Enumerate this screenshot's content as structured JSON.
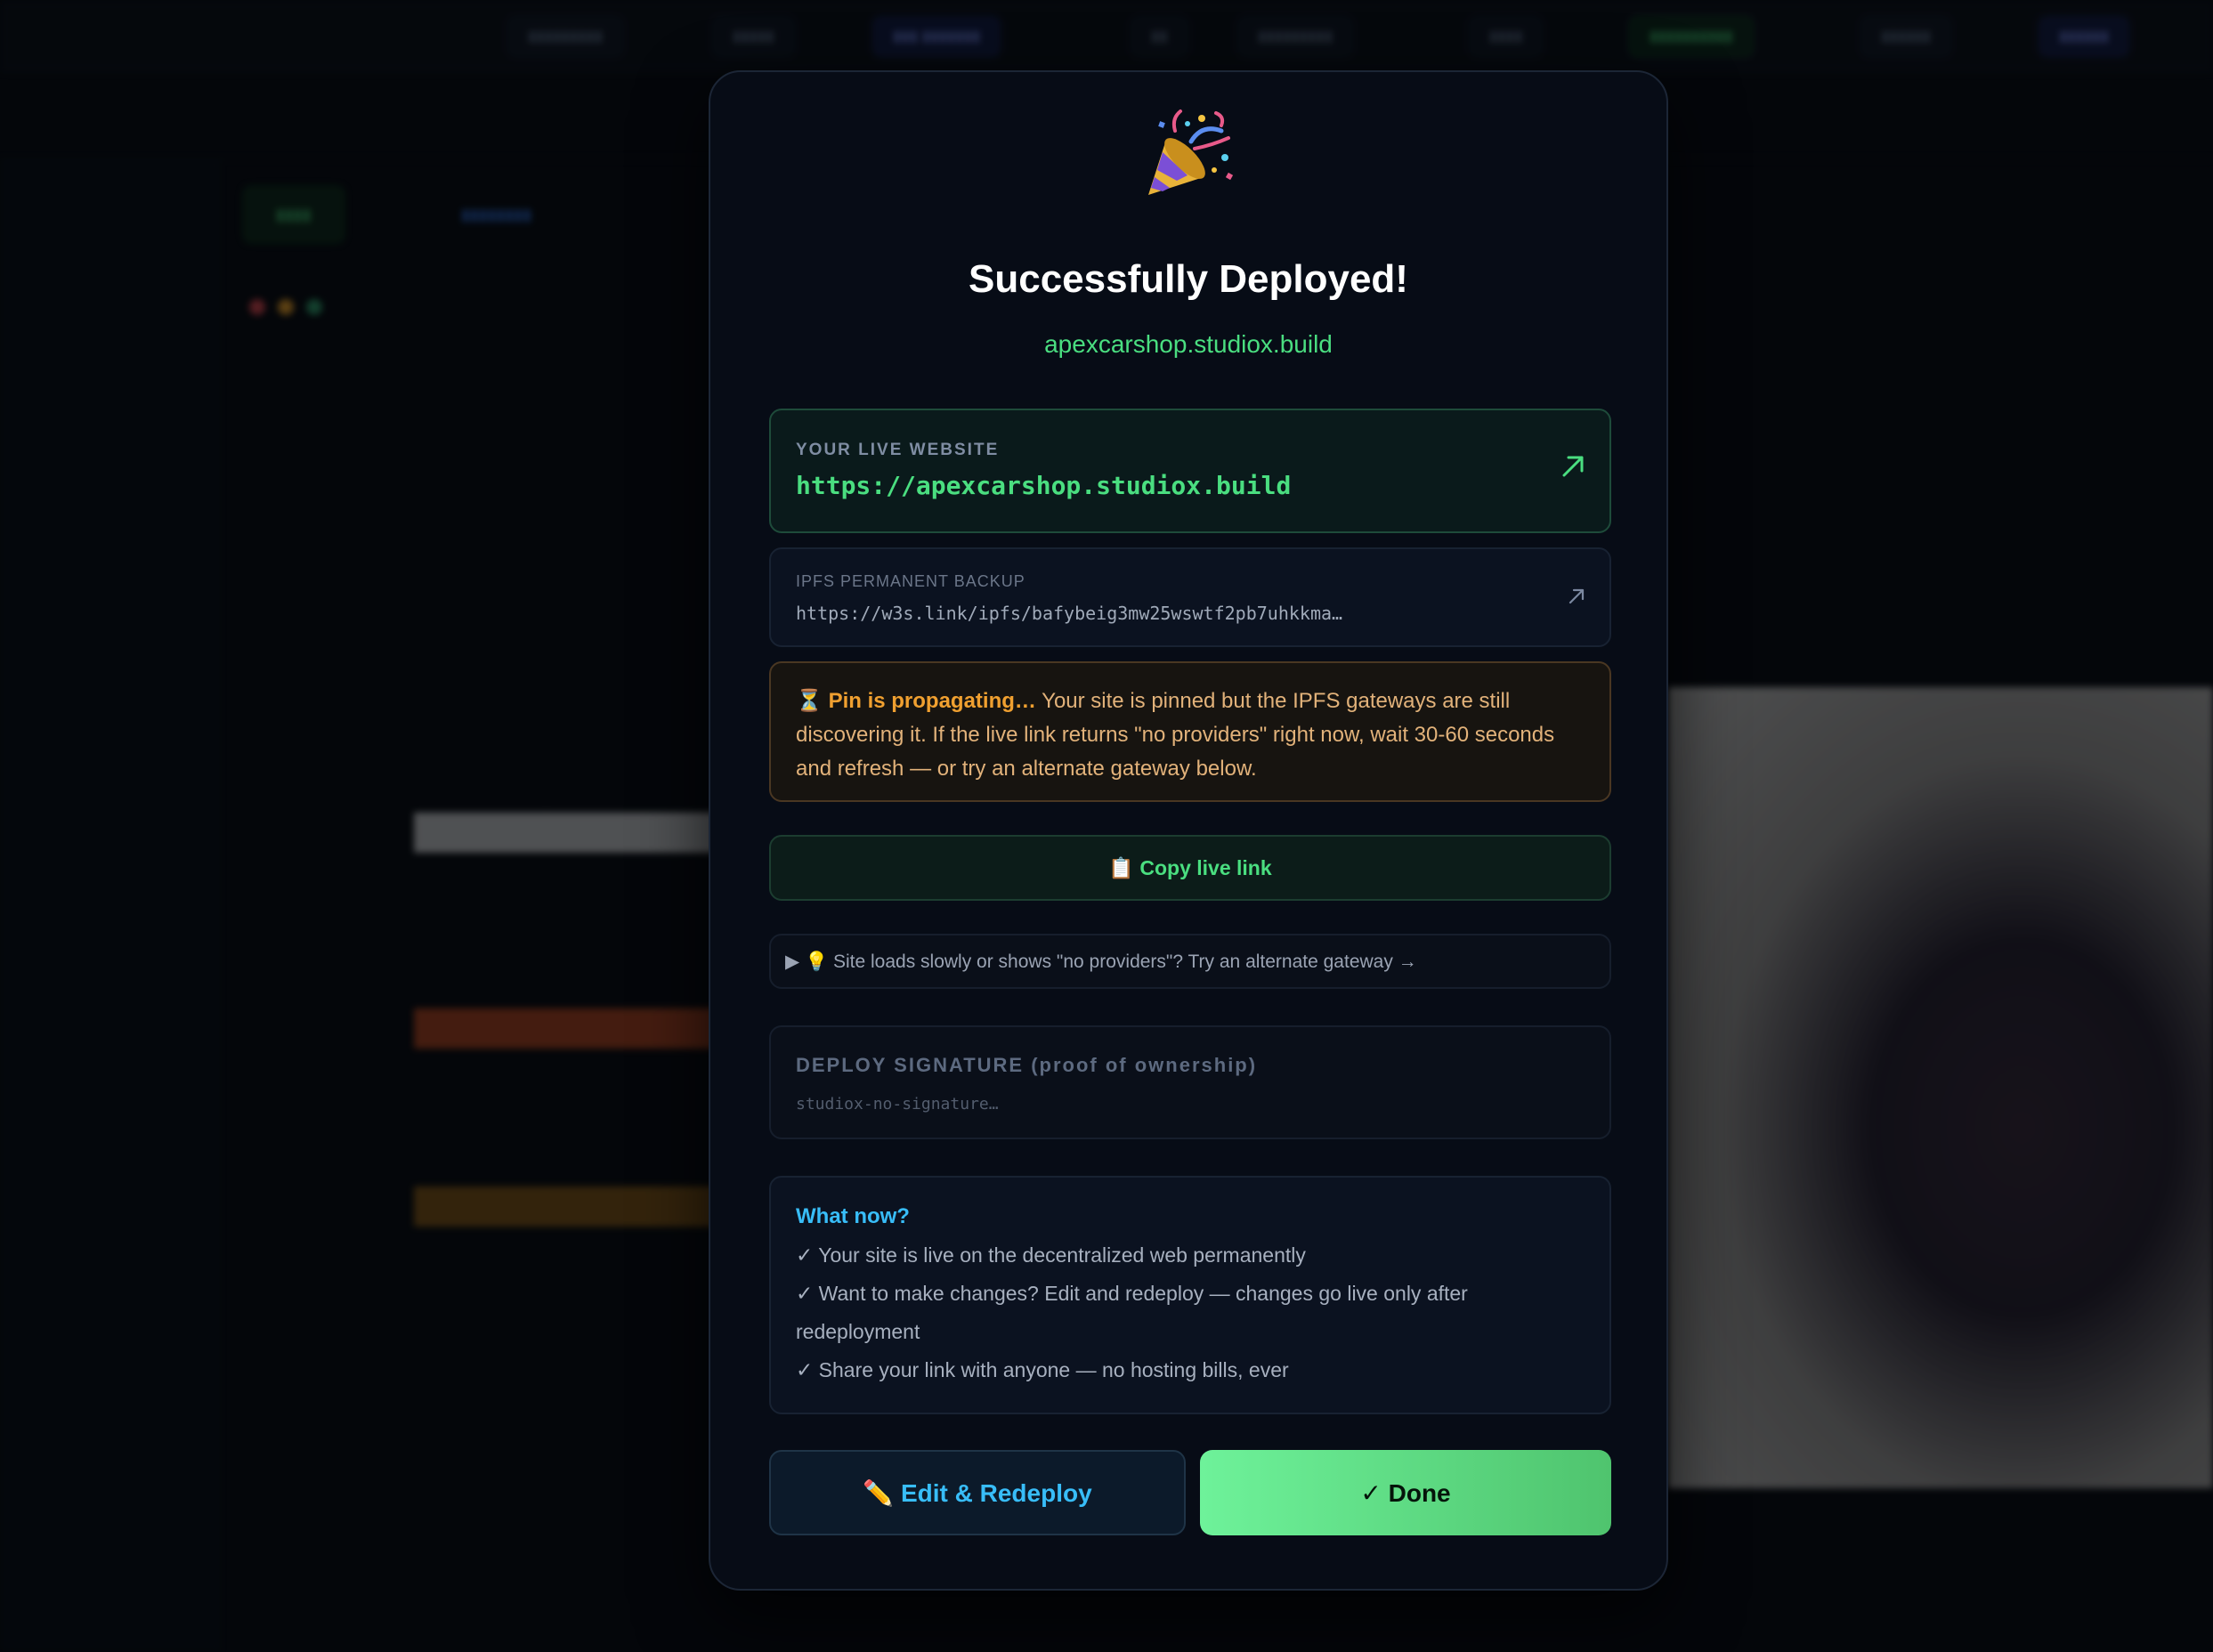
{
  "modal": {
    "icon": "party-popper-icon",
    "title": "Successfully Deployed!",
    "domain": "apexcarshop.studiox.build",
    "live": {
      "label": "YOUR LIVE WEBSITE",
      "url": "https://apexcarshop.studiox.build",
      "icon": "external-link-arrow-icon"
    },
    "ipfs": {
      "label": "IPFS PERMANENT BACKUP",
      "url": "https://w3s.link/ipfs/bafybeig3mw25wswtf2pb7uhkkma…",
      "icon": "external-link-arrow-icon"
    },
    "warning": {
      "emoji": "⏳",
      "bold": "Pin is propagating…",
      "text": " Your site is pinned but the IPFS gateways are still discovering it. If the live link returns \"no providers\" right now, wait 30-60 seconds and refresh — or try an alternate gateway below."
    },
    "copy_button": "📋 Copy live link",
    "gateway_toggle": "▶ 💡 Site loads slowly or shows \"no providers\"? Try an alternate gateway →",
    "signature": {
      "label": "DEPLOY SIGNATURE (proof of ownership)",
      "value": "studiox-no-signature…"
    },
    "what_now": {
      "title": "What now?",
      "items": [
        "✓ Your site is live on the decentralized web permanently",
        "✓ Want to make changes? Edit and redeploy — changes go live only after redeployment",
        "✓ Share your link with anyone — no hosting bills, ever"
      ]
    },
    "edit_button": "✏️ Edit & Redeploy",
    "done_button": "✓ Done"
  },
  "colors": {
    "accent_green": "#4ade80",
    "accent_blue": "#38bdf8",
    "warning_orange": "#f0a030",
    "modal_bg": "#070c16"
  }
}
